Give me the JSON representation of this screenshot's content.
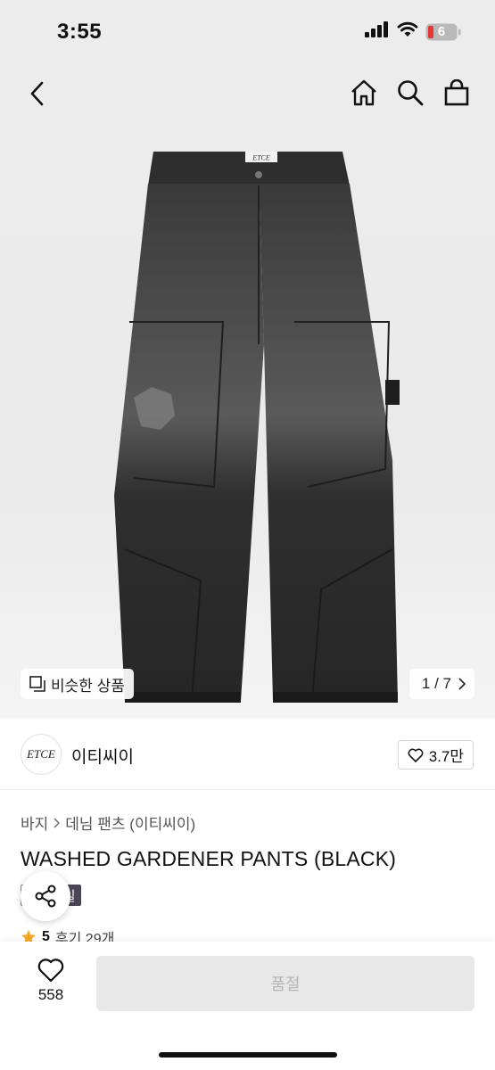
{
  "status_bar": {
    "time": "3:55",
    "battery": "6",
    "icons": [
      "signal-icon",
      "wifi-icon",
      "battery-icon"
    ]
  },
  "nav": {
    "icons": [
      "back-icon",
      "home-icon",
      "search-icon",
      "shopping-bag-icon"
    ]
  },
  "hero": {
    "similar_label": "비슷한 상품",
    "page_indicator": "1 / 7",
    "waist_label": "ETCE"
  },
  "brand": {
    "logo_text": "ETCE",
    "name": "이티씨이",
    "likes": "3.7만"
  },
  "product": {
    "breadcrumb": [
      "바지",
      "데님 팬츠 (이티씨이)"
    ],
    "title": "WASHED GARDENER PANTS (BLACK)",
    "sale_tag": "세일",
    "rating": "5",
    "reviews": "후기 29개"
  },
  "bottom_bar": {
    "wish_count": "558",
    "soldout_label": "품절"
  },
  "colors": {
    "background": "#ececec",
    "sale_tag": "#4a4557",
    "star": "#f5a623",
    "disabled_button": "#e8e8e8"
  }
}
